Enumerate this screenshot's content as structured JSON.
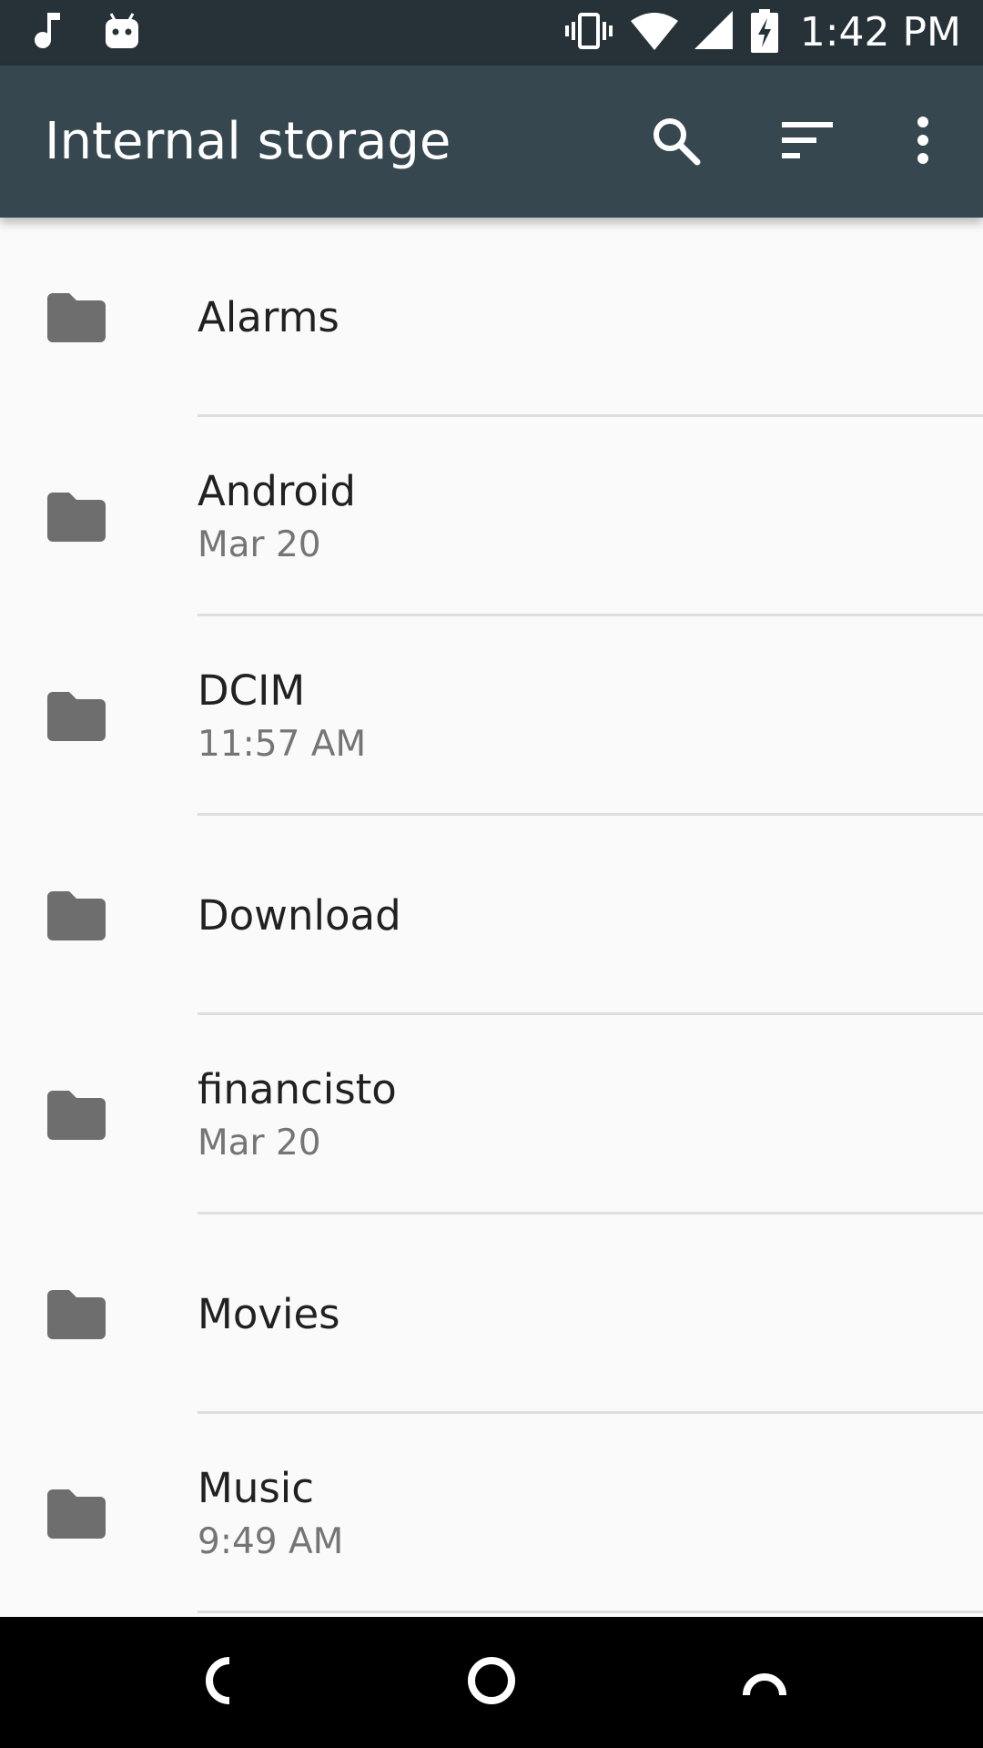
{
  "status_bar": {
    "time": "1:42 PM",
    "left_icons": [
      "music-note-icon",
      "android-debug-icon"
    ],
    "right_icons": [
      "vibrate-icon",
      "wifi-icon",
      "cell-signal-icon",
      "battery-charging-icon"
    ]
  },
  "toolbar": {
    "title": "Internal storage",
    "actions": [
      "search-icon",
      "sort-icon",
      "more-vert-icon"
    ]
  },
  "files": [
    {
      "name": "Alarms",
      "date": ""
    },
    {
      "name": "Android",
      "date": "Mar 20"
    },
    {
      "name": "DCIM",
      "date": "11:57 AM"
    },
    {
      "name": "Download",
      "date": ""
    },
    {
      "name": "financisto",
      "date": "Mar 20"
    },
    {
      "name": "Movies",
      "date": ""
    },
    {
      "name": "Music",
      "date": "9:49 AM"
    }
  ],
  "nav_bar": {
    "buttons": [
      "back-icon",
      "home-icon",
      "recents-icon"
    ]
  },
  "colors": {
    "status_bar": "#263238",
    "toolbar": "#37474f",
    "background": "#fafafa",
    "folder_icon": "#6e6e6e",
    "primary_text": "#212121",
    "secondary_text": "#757575"
  }
}
